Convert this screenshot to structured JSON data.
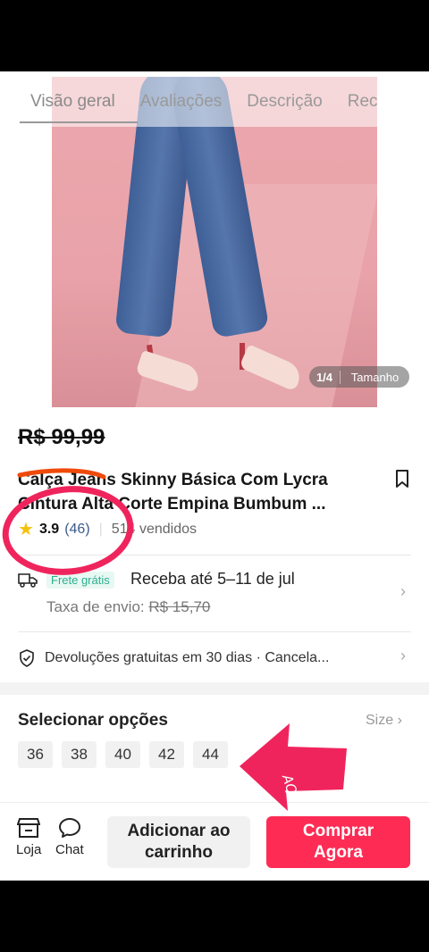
{
  "tabs": [
    {
      "label": "Visão geral"
    },
    {
      "label": "Avaliações"
    },
    {
      "label": "Descrição"
    },
    {
      "label": "Rec"
    }
  ],
  "image": {
    "counter": "1/4",
    "size_label": "Tamanho"
  },
  "product": {
    "price": "R$ 99,99",
    "title": "Calça Jeans Skinny Básica Com Lycra Cintura Alta Corte Empina Bumbum ...",
    "rating": "3.9",
    "review_count": "(46)",
    "sold": "514 vendidos"
  },
  "shipping": {
    "badge": "Frete grátis",
    "receive": "Receba até 5–11 de jul",
    "fee_label": "Taxa de envio:",
    "fee_old": "R$ 15,70"
  },
  "returns": {
    "text": "Devoluções gratuitas em 30 dias · Cancela..."
  },
  "options": {
    "title": "Selecionar opções",
    "size_link": "Size",
    "sizes": [
      "36",
      "38",
      "40",
      "42",
      "44"
    ]
  },
  "annotation": {
    "text": "AQUI!",
    "color": "#f0245c"
  },
  "bottom": {
    "store_label": "Loja",
    "chat_label": "Chat",
    "cart_line1": "Adicionar ao",
    "cart_line2": "carrinho",
    "buy_line1": "Comprar",
    "buy_line2": "Agora"
  },
  "colors": {
    "accent": "#fe2c55",
    "free_shipping": "#2bb08a"
  }
}
